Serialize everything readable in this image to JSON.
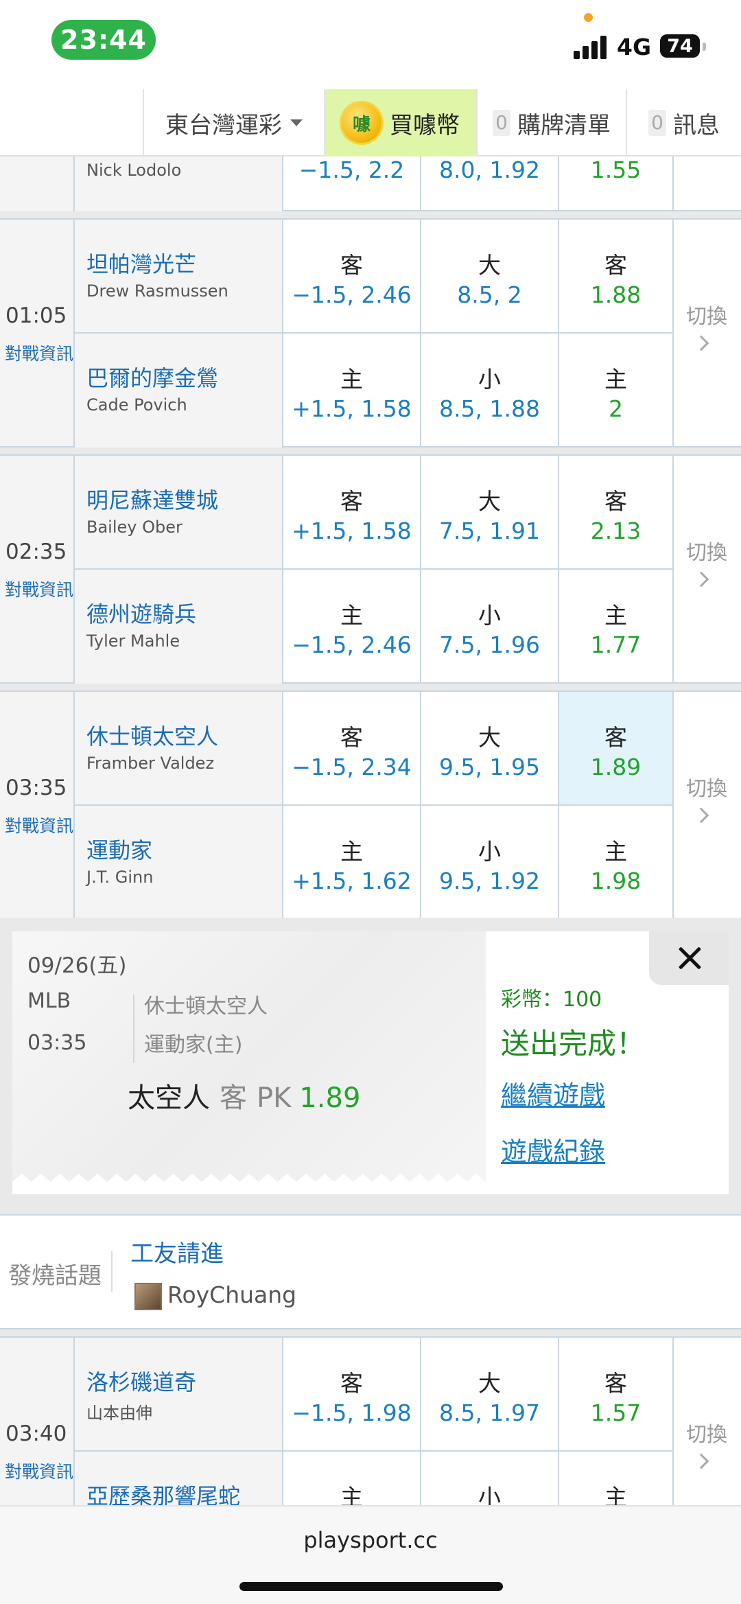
{
  "status_bar": {
    "time": "23:44",
    "network": "4G",
    "battery": "74"
  },
  "tabs": {
    "region": "東台灣運彩",
    "buy_coins": "買噱幣",
    "coin_glyph": "噱",
    "cart_count": "0",
    "cart": "購牌清單",
    "msg_count": "0",
    "messages": "訊息"
  },
  "partial_game": {
    "pitcher": "Nick Lodolo",
    "spread": "−1.5, 2.2",
    "total": "8.0, 1.92",
    "moneyline": "1.55"
  },
  "games": [
    {
      "time": "01:05",
      "info_label": "對戰資訊",
      "switch_label": "切換",
      "away": {
        "team": "坦帕灣光芒",
        "pitcher": "Drew Rasmussen",
        "spread_label": "客",
        "spread": "−1.5, 2.46",
        "total_label": "大",
        "total": "8.5, 2",
        "ml_label": "客",
        "ml": "1.88"
      },
      "home": {
        "team": "巴爾的摩金鶯",
        "pitcher": "Cade Povich",
        "spread_label": "主",
        "spread": "+1.5, 1.58",
        "total_label": "小",
        "total": "8.5, 1.88",
        "ml_label": "主",
        "ml": "2"
      }
    },
    {
      "time": "02:35",
      "info_label": "對戰資訊",
      "switch_label": "切換",
      "away": {
        "team": "明尼蘇達雙城",
        "pitcher": "Bailey Ober",
        "spread_label": "客",
        "spread": "+1.5, 1.58",
        "total_label": "大",
        "total": "7.5, 1.91",
        "ml_label": "客",
        "ml": "2.13"
      },
      "home": {
        "team": "德州遊騎兵",
        "pitcher": "Tyler Mahle",
        "spread_label": "主",
        "spread": "−1.5, 2.46",
        "total_label": "小",
        "total": "7.5, 1.96",
        "ml_label": "主",
        "ml": "1.77"
      }
    },
    {
      "time": "03:35",
      "info_label": "對戰資訊",
      "switch_label": "切換",
      "away": {
        "team": "休士頓太空人",
        "pitcher": "Framber Valdez",
        "spread_label": "客",
        "spread": "−1.5, 2.34",
        "total_label": "大",
        "total": "9.5, 1.95",
        "ml_label": "客",
        "ml": "1.89"
      },
      "home": {
        "team": "運動家",
        "pitcher": "J.T. Ginn",
        "spread_label": "主",
        "spread": "+1.5, 1.62",
        "total_label": "小",
        "total": "9.5, 1.92",
        "ml_label": "主",
        "ml": "1.98"
      }
    },
    {
      "time": "03:40",
      "info_label": "對戰資訊",
      "switch_label": "切換",
      "away": {
        "team": "洛杉磯道奇",
        "pitcher": "山本由伸",
        "spread_label": "客",
        "spread": "−1.5, 1.98",
        "total_label": "大",
        "total": "8.5, 1.97",
        "ml_label": "客",
        "ml": "1.57"
      },
      "home": {
        "team": "亞歷桑那響尾蛇",
        "pitcher": "",
        "spread_label": "主",
        "spread": "",
        "total_label": "小",
        "total": "",
        "ml_label": "主",
        "ml": ""
      }
    }
  ],
  "confirmation": {
    "date": "09/26(五)",
    "league": "MLB",
    "time": "03:35",
    "away_team": "休士頓太空人",
    "home_team": "運動家(主)",
    "pick_team": "太空人",
    "pick_side": "客",
    "pick_type": "PK",
    "pick_odds": "1.89",
    "coins": "彩幣：100",
    "done": "送出完成！",
    "continue": "繼續遊戲",
    "history": "遊戲紀錄"
  },
  "hot_topic": {
    "label": "發燒話題",
    "title": "工友請進",
    "user": "RoyChuang"
  },
  "url": "playsport.cc"
}
